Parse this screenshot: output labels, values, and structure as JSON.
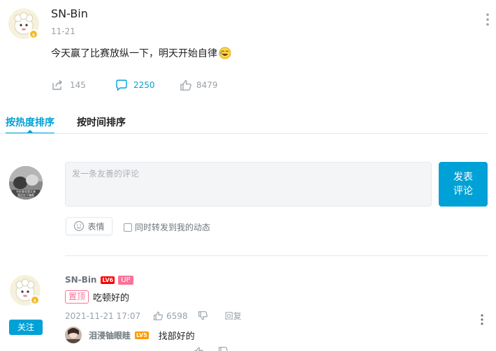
{
  "post": {
    "author": "SN-Bin",
    "date": "11-21",
    "text": "今天赢了比赛放纵一下，明天开始自律",
    "stats": {
      "share": "145",
      "comment": "2250",
      "like": "8479"
    }
  },
  "sort_tabs": [
    {
      "label": "按热度排序",
      "active": true
    },
    {
      "label": "按时间排序",
      "active": false
    }
  ],
  "composer": {
    "placeholder": "发一条友善的评论",
    "submit_line1": "发表",
    "submit_line2": "评论",
    "emoji_label": "表情",
    "forward_label": "同时转发到我的动态",
    "avatar_caption_line1": "不好意思我又来",
    "avatar_caption_line2": "我还在干嘛呢"
  },
  "comment": {
    "author": "SN-Bin",
    "level": "LV6",
    "up_badge": "UP",
    "pinned_tag": "置顶",
    "text": "吃顿好的",
    "time": "2021-11-21 17:07",
    "likes": "6598",
    "reply_label": "回复",
    "follow_label": "关注"
  },
  "reply": {
    "author": "泪浸铀眼眭",
    "level": "LV5",
    "text": "找部好的"
  },
  "colors": {
    "accent": "#00a1d6",
    "pink": "#fb7299",
    "lv6": "#ff0000",
    "lv5": "#ff9900"
  }
}
